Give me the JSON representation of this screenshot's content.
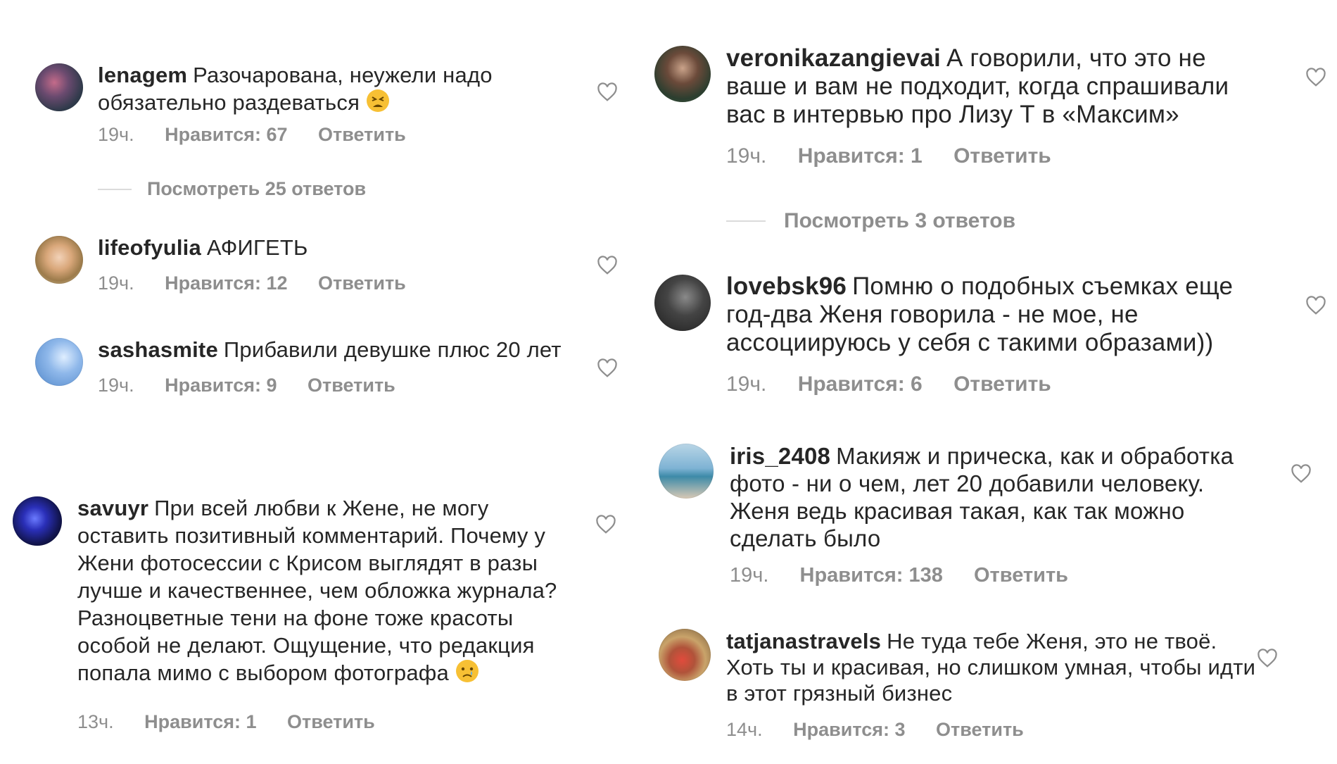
{
  "left_column": [
    {
      "user": "lenagem",
      "text": "Разочарована, неужели надо обязательно раздеваться",
      "emoji": "tired-face-emoji",
      "time": "19ч.",
      "likes": "Нравится: 67",
      "reply": "Ответить",
      "view_replies": "Посмотреть 25 ответов"
    },
    {
      "user": "lifeofyulia",
      "text": "АФИГЕТЬ",
      "time": "19ч.",
      "likes": "Нравится: 12",
      "reply": "Ответить"
    },
    {
      "user": "sashasmite",
      "text": "Прибавили девушке плюс 20 лет",
      "time": "19ч.",
      "likes": "Нравится: 9",
      "reply": "Ответить"
    },
    {
      "user": "savuyr",
      "text": "При всей любви к Жене, не могу оставить позитивный комментарий. Почему у Жени фотосессии с Крисом выглядят в разы лучше и качественнее, чем обложка журнала? Разноцветные тени на фоне тоже красоты особой не делают. Ощущение, что редакция попала мимо с выбором фотографа",
      "emoji": "crying-face-emoji",
      "time": "13ч.",
      "likes": "Нравится: 1",
      "reply": "Ответить"
    }
  ],
  "right_column": [
    {
      "user": "veronikazangievai",
      "text": "А говорили, что это не ваше и вам не подходит, когда спрашивали вас в интервью про Лизу Т в «Максим»",
      "time": "19ч.",
      "likes": "Нравится: 1",
      "reply": "Ответить",
      "view_replies": "Посмотреть 3 ответов"
    },
    {
      "user": "lovebsk96",
      "text": "Помню о подобных съемках еще год-два Женя говорила - не мое, не ассоциируюсь у себя с такими образами))",
      "time": "19ч.",
      "likes": "Нравится: 6",
      "reply": "Ответить"
    },
    {
      "user": "iris_2408",
      "text": "Макияж и прическа, как и обработка фото - ни о чем, лет 20 добавили человеку. Женя ведь красивая такая, как так можно сделать было",
      "time": "19ч.",
      "likes": "Нравится: 138",
      "reply": "Ответить"
    },
    {
      "user": "tatjanastravels",
      "text": "Не туда тебе Женя, это не твоё. Хоть ты и красивая, но слишком умная, чтобы идти в этот грязный бизнес",
      "time": "14ч.",
      "likes": "Нравится: 3",
      "reply": "Ответить"
    }
  ],
  "colors": {
    "text": "#262626",
    "meta": "#8e8e8e",
    "heart": "#8e8e8e"
  }
}
